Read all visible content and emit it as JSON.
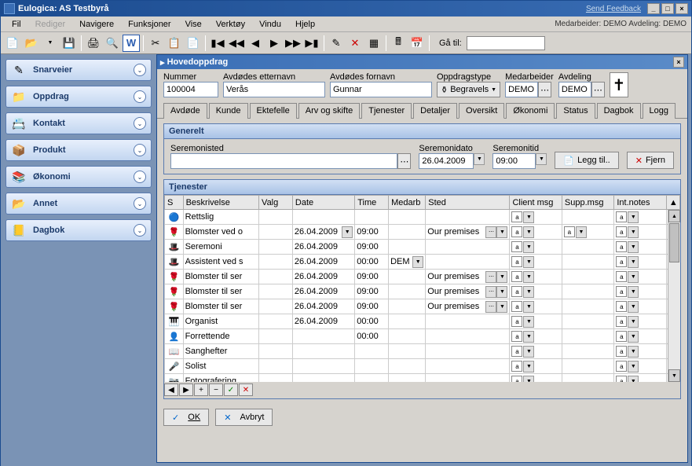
{
  "title": "Eulogica: AS Testbyrå",
  "feedback": "Send Feedback",
  "menu": {
    "fil": "Fil",
    "rediger": "Rediger",
    "navigere": "Navigere",
    "funksjoner": "Funksjoner",
    "vise": "Vise",
    "verktoy": "Verktøy",
    "vindu": "Vindu",
    "hjelp": "Hjelp",
    "status": "Medarbeider: DEMO   Avdeling: DEMO"
  },
  "goto": {
    "label": "Gå til:",
    "value": ""
  },
  "sidebar": [
    {
      "label": "Snarveier",
      "icon": "✎"
    },
    {
      "label": "Oppdrag",
      "icon": "📁"
    },
    {
      "label": "Kontakt",
      "icon": "📇"
    },
    {
      "label": "Produkt",
      "icon": "📦"
    },
    {
      "label": "Økonomi",
      "icon": "📚"
    },
    {
      "label": "Annet",
      "icon": "📂"
    },
    {
      "label": "Dagbok",
      "icon": "📒"
    }
  ],
  "subwin": {
    "title": "Hovedoppdrag"
  },
  "header": {
    "nummer": {
      "label": "Nummer",
      "value": "100004"
    },
    "etternavn": {
      "label": "Avdødes etternavn",
      "value": "Verås"
    },
    "fornavn": {
      "label": "Avdødes fornavn",
      "value": "Gunnar"
    },
    "oppdragstype": {
      "label": "Oppdragstype",
      "value": "Begravels"
    },
    "medarbeider": {
      "label": "Medarbeider",
      "value": "DEMO"
    },
    "avdeling": {
      "label": "Avdeling",
      "value": "DEMO"
    }
  },
  "tabs": [
    "Avdøde",
    "Kunde",
    "Ektefelle",
    "Arv og skifte",
    "Tjenester",
    "Detaljer",
    "Oversikt",
    "Økonomi",
    "Status",
    "Dagbok",
    "Logg"
  ],
  "active_tab": 6,
  "generelt": {
    "title": "Generelt",
    "seremonisted": {
      "label": "Seremonisted",
      "value": ""
    },
    "seremonidato": {
      "label": "Seremonidato",
      "value": "26.04.2009"
    },
    "seremonitid": {
      "label": "Seremonitid",
      "value": "09:00"
    },
    "leggtil": "Legg til..",
    "fjern": "Fjern"
  },
  "tjenester": {
    "title": "Tjenester",
    "cols": [
      "S",
      "Beskrivelse",
      "Valg",
      "Date",
      "Time",
      "Medarb",
      "Sted",
      "Client msg",
      "Supp.msg",
      "Int.notes"
    ],
    "rows": [
      {
        "icon": "🔵",
        "besk": "Rettslig",
        "date": "",
        "time": "",
        "med": "",
        "sted": "",
        "cm": "a",
        "sm": "",
        "in": "a"
      },
      {
        "icon": "🌹",
        "besk": "Blomster ved o",
        "date": "26.04.2009",
        "time": "09:00",
        "med": "",
        "sted": "Our premises",
        "cm": "a",
        "sm": "a",
        "in": "a",
        "dd": true,
        "sdd": true
      },
      {
        "icon": "🎩",
        "besk": "Seremoni",
        "date": "26.04.2009",
        "time": "09:00",
        "med": "",
        "sted": "",
        "cm": "a",
        "sm": "",
        "in": "a"
      },
      {
        "icon": "🎩",
        "besk": "Assistent ved s",
        "date": "26.04.2009",
        "time": "00:00",
        "med": "DEM",
        "sted": "",
        "cm": "a",
        "sm": "",
        "in": "a",
        "mdd": true
      },
      {
        "icon": "🌹",
        "besk": "Blomster til ser",
        "date": "26.04.2009",
        "time": "09:00",
        "med": "",
        "sted": "Our premises",
        "cm": "a",
        "sm": "",
        "in": "a",
        "sdd": true
      },
      {
        "icon": "🌹",
        "besk": "Blomster til ser",
        "date": "26.04.2009",
        "time": "09:00",
        "med": "",
        "sted": "Our premises",
        "cm": "a",
        "sm": "",
        "in": "a",
        "sdd": true
      },
      {
        "icon": "🌹",
        "besk": "Blomster til ser",
        "date": "26.04.2009",
        "time": "09:00",
        "med": "",
        "sted": "Our premises",
        "cm": "a",
        "sm": "",
        "in": "a",
        "sdd": true
      },
      {
        "icon": "🎹",
        "besk": "Organist",
        "date": "26.04.2009",
        "time": "00:00",
        "med": "",
        "sted": "",
        "cm": "a",
        "sm": "",
        "in": "a"
      },
      {
        "icon": "👤",
        "besk": "Forrettende",
        "date": "",
        "time": "00:00",
        "med": "",
        "sted": "",
        "cm": "a",
        "sm": "",
        "in": "a"
      },
      {
        "icon": "📖",
        "besk": "Sanghefter",
        "date": "",
        "time": "",
        "med": "",
        "sted": "",
        "cm": "a",
        "sm": "",
        "in": "a"
      },
      {
        "icon": "🎤",
        "besk": "Solist",
        "date": "",
        "time": "",
        "med": "",
        "sted": "",
        "cm": "a",
        "sm": "",
        "in": "a"
      },
      {
        "icon": "📷",
        "besk": "Fotografering",
        "date": "",
        "time": "",
        "med": "",
        "sted": "",
        "cm": "a",
        "sm": "",
        "in": "a"
      }
    ]
  },
  "buttons": {
    "ok": "OK",
    "avbryt": "Avbryt"
  }
}
